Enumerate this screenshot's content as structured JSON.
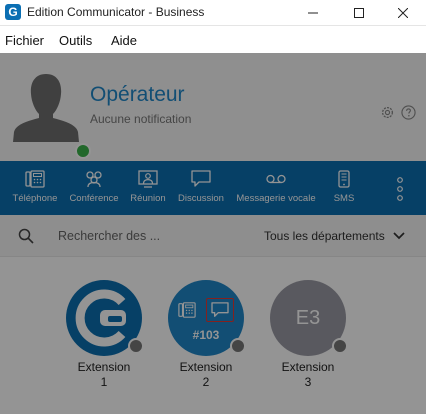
{
  "window": {
    "title": "Edition Communicator - Business",
    "logo_letter": "G"
  },
  "menu": [
    "Fichier",
    "Outils",
    "Aide"
  ],
  "profile": {
    "name": "Opérateur",
    "notification": "Aucune notification",
    "presence_color": "#3bb34a"
  },
  "toolbar": {
    "background": "#0c6fb0",
    "items": [
      {
        "label": "Téléphone",
        "icon": "phone-icon"
      },
      {
        "label": "Conférence",
        "icon": "conference-icon"
      },
      {
        "label": "Réunion",
        "icon": "meeting-icon"
      },
      {
        "label": "Discussion",
        "icon": "chat-icon"
      },
      {
        "label": "Messagerie vocale",
        "icon": "voicemail-icon"
      },
      {
        "label": "SMS",
        "icon": "sms-icon"
      }
    ]
  },
  "search": {
    "placeholder": "Rechercher des ...",
    "department": "Tous les départements"
  },
  "extensions": [
    {
      "label": "Extension",
      "number": "1",
      "type": "logo"
    },
    {
      "label": "Extension",
      "number": "2",
      "type": "hover",
      "hover_number": "#103"
    },
    {
      "label": "Extension",
      "number": "3",
      "type": "initials",
      "initials": "E3"
    }
  ]
}
